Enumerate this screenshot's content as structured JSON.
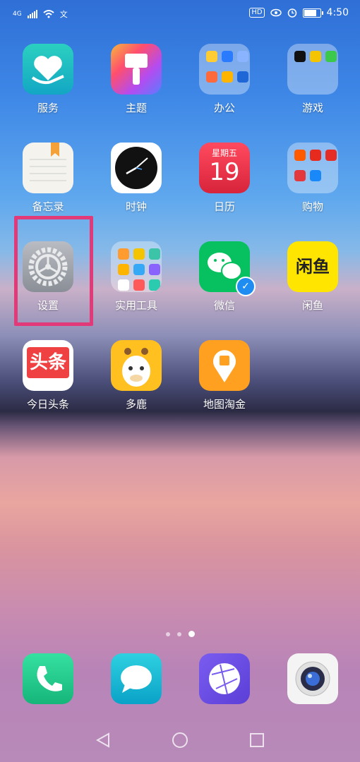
{
  "status": {
    "network": "4G",
    "time": "4:50",
    "hd": "HD",
    "battery_level": 0.85
  },
  "apps": [
    {
      "label": "服务"
    },
    {
      "label": "主题"
    },
    {
      "label": "办公"
    },
    {
      "label": "游戏"
    },
    {
      "label": "备忘录"
    },
    {
      "label": "时钟"
    },
    {
      "label": "日历"
    },
    {
      "label": "购物"
    },
    {
      "label": "设置"
    },
    {
      "label": "实用工具"
    },
    {
      "label": "微信"
    },
    {
      "label": "闲鱼"
    },
    {
      "label": "今日头条"
    },
    {
      "label": "多鹿"
    },
    {
      "label": "地图淘金"
    }
  ],
  "calendar": {
    "weekday": "星期五",
    "day": "19"
  },
  "toutiao_text": "头条",
  "xianyu_text": "闲鱼",
  "dock": [
    "phone-icon",
    "messages-icon",
    "browser-icon",
    "camera-icon"
  ],
  "colors": {
    "highlight": "#e23a79",
    "wechat_green": "#07c160"
  }
}
